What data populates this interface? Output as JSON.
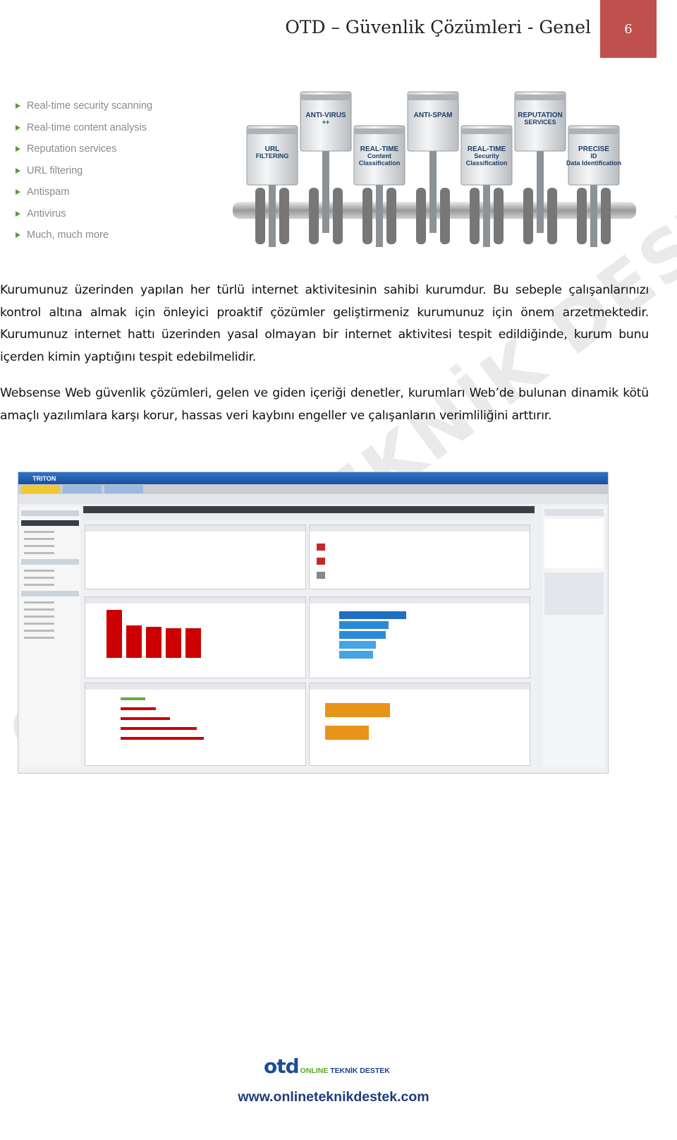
{
  "header": {
    "title": "OTD – Güvenlik Çözümleri - Genel",
    "page_number": "6",
    "accent": "#c0504d"
  },
  "features": [
    "Real-time security scanning",
    "Real-time content analysis",
    "Reputation services",
    "URL filtering",
    "Antispam",
    "Antivirus",
    "Much, much more"
  ],
  "engine_pistons": [
    {
      "label": "URL FILTERING",
      "high": false
    },
    {
      "label": "ANTI-VIRUS ++",
      "high": true
    },
    {
      "label": "REAL-TIME Content Classification",
      "high": false
    },
    {
      "label": "ANTI-SPAM",
      "high": true
    },
    {
      "label": "REAL-TIME Security Classification",
      "high": false
    },
    {
      "label": "REPUTATION SERVICES",
      "high": true
    },
    {
      "label": "PRECISE ID Data Identification",
      "high": false
    }
  ],
  "paragraphs": [
    "Kurumunuz üzerinden yapılan her türlü internet aktivitesinin sahibi kurumdur. Bu sebeple çalışanlarınızı kontrol altına almak için önleyici proaktif çözümler geliştirmeniz kurumunuz için önem arzetmektedir. Kurumunuz internet hattı üzerinden yasal olmayan bir internet aktivitesi tespit edildiğinde, kurum bunu içerden kimin yaptığını tespit edebilmelidir.",
    "Websense Web güvenlik çözümleri, gelen ve giden içeriği denetler, kurumları Web’de bulunan dinamik kötü amaçlı yazılımlara karşı korur, hassas veri kaybını engeller ve çalışanların verimliliğini arttırır."
  ],
  "screenshot": {
    "app_name": "TRITON"
  },
  "watermark": "ONLINE TEKNİK DESTEK",
  "footer": {
    "logo_main": "otd",
    "logo_online": "ONLINE",
    "logo_rest": "TEKNİK DESTEK",
    "url": "www.onlineteknikdestek.com"
  }
}
